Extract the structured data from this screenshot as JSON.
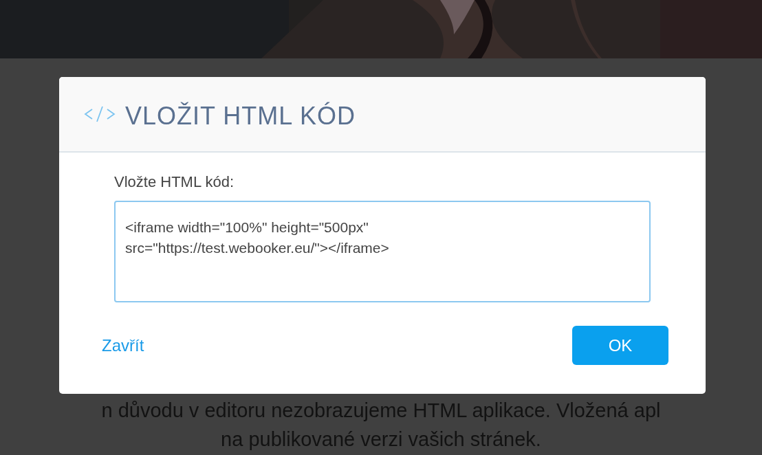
{
  "background_text": [
    "n důvodu v editoru nezobrazujeme HTML aplikace. Vložená apl",
    "na publikované verzi vašich stránek."
  ],
  "dialog": {
    "title": "VLOŽIT HTML KÓD",
    "field": {
      "label": "Vložte HTML kód:",
      "value": "<iframe width=\"100%\" height=\"500px\" src=\"https://test.webooker.eu/\"></iframe>"
    },
    "close_link": "Zavřít",
    "ok_button": "OK"
  }
}
